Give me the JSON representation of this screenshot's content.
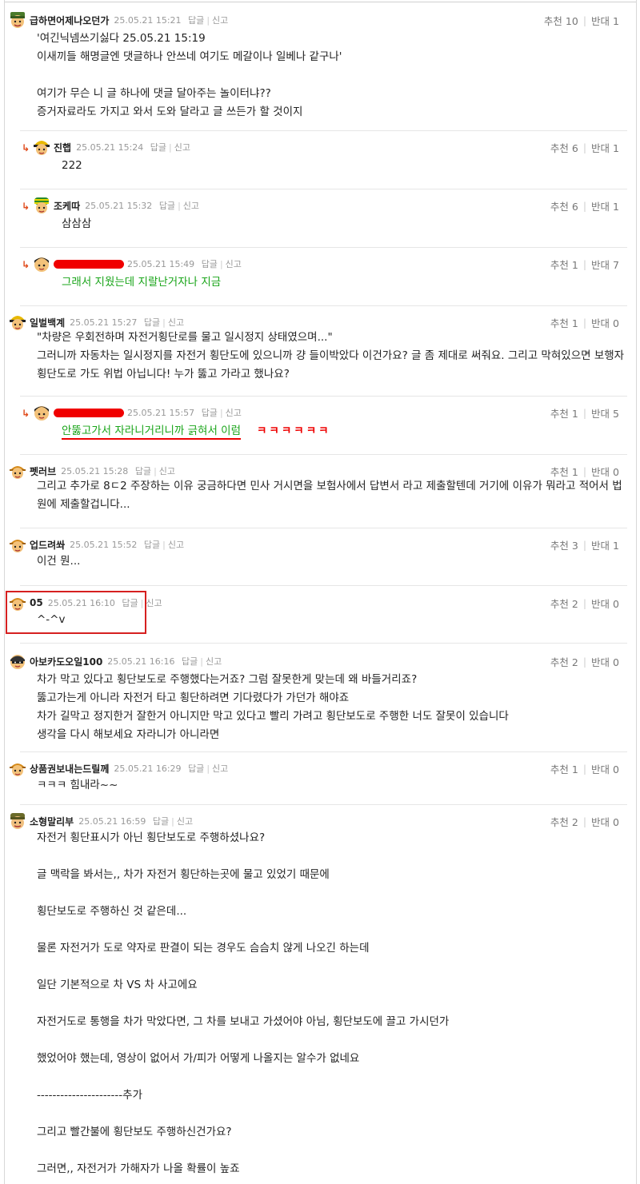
{
  "labels": {
    "reply": "답글",
    "report": "신고",
    "upvote": "추천",
    "downvote": "반대"
  },
  "comments": [
    {
      "nick": "급하면어제나오던가",
      "date": "25.05.21 15:21",
      "up": 10,
      "down": 1,
      "lines": [
        "'여긴닉넴쓰기싫다 25.05.21 15:19",
        "이새끼들 해명글엔 댓글하나 안쓰네 여기도 메갈이나 일베나 같구나'",
        "",
        "여기가 무슨 니 글 하나에 댓글 달아주는 놀이터냐??",
        "증거자료라도 가지고 와서 도와 달라고 글 쓰든가 할 것이지"
      ]
    },
    {
      "nick": "진햅",
      "date": "25.05.21 15:24",
      "up": 6,
      "down": 1,
      "lines": [
        "222"
      ]
    },
    {
      "nick": "조케따",
      "date": "25.05.21 15:32",
      "up": 6,
      "down": 1,
      "lines": [
        "삼삼삼"
      ]
    },
    {
      "nick": "",
      "date": "25.05.21 15:49",
      "up": 1,
      "down": 7,
      "lines": [
        "그래서 지웠는데 지랄난거자나 지금"
      ]
    },
    {
      "nick": "일벌백계",
      "date": "25.05.21 15:27",
      "up": 1,
      "down": 0,
      "lines": [
        "\"차량은 우회전하며 자전거횡단로를 물고 일시정지 상태였으며...\"",
        "그러니까 자동차는 일시정지를 자전거 횡단도에 있으니까 걍 들이박았다 이건가요? 글 좀 제대로 써줘요. 그리고 막혀있으면 보행자",
        "횡단도로 가도 위법 아닙니다! 누가 뚫고 가라고 했나요?"
      ]
    },
    {
      "nick": "",
      "date": "25.05.21 15:57",
      "up": 1,
      "down": 5,
      "lines": [
        "안뚫고가서 자라니거리니까 긁혀서 이럼"
      ],
      "extra": "ㅋㅋㅋㅋㅋㅋ"
    },
    {
      "nick": "펫러브",
      "date": "25.05.21 15:28",
      "up": 1,
      "down": 0,
      "lines": [
        "그리고 추가로 8ㄷ2 주장하는 이유 궁금하다면 민사 거시면을 보험사에서 답변서 라고 제출할텐데 거기에 이유가 뭐라고 적어서 법",
        "원에 제출할겁니다..."
      ]
    },
    {
      "nick": "업드려쏴",
      "date": "25.05.21 15:52",
      "up": 3,
      "down": 1,
      "lines": [
        "이건 뭔..."
      ]
    },
    {
      "nick": "05",
      "date": "25.05.21 16:10",
      "up": 2,
      "down": 0,
      "lines": [
        "^-^v"
      ]
    },
    {
      "nick": "아보카도오일100",
      "date": "25.05.21 16:16",
      "up": 2,
      "down": 0,
      "lines": [
        "차가 막고 있다고 횡단보도로 주행했다는거죠? 그럼 잘못한게 맞는데 왜 바들거리죠?",
        "뚫고가는게 아니라 자전거 타고 횡단하려면 기다렸다가 가던가 해야죠",
        "차가 길막고 정지한거 잘한거 아니지만 막고 있다고 빨리 가려고 횡단보도로 주행한 너도 잘못이 있습니다",
        "생각을 다시 해보세요 자라니가 아니라면"
      ]
    },
    {
      "nick": "상품권보내는드릴께",
      "date": "25.05.21 16:29",
      "up": 1,
      "down": 0,
      "lines": [
        "ㅋㅋㅋ 힘내라~~"
      ]
    },
    {
      "nick": "소형말리부",
      "date": "25.05.21 16:59",
      "up": 2,
      "down": 0,
      "lines": [
        "자전거 횡단표시가 아닌 횡단보도로 주행하셨나요?",
        "",
        "글 맥락을 봐서는,, 차가 자전거 횡단하는곳에 물고 있었기 때문에",
        "",
        "횡단보도로 주행하신 것 같은데...",
        "",
        "물론 자전거가 도로 약자로 판결이 되는 경우도 슴슴치 않게 나오긴 하는데",
        "",
        "일단 기본적으로 차 VS 차 사고에요",
        "",
        "자전거도로 통행을 차가 막았다면, 그 차를 보내고 가셨어야 아님, 횡단보도에 끌고 가시던가",
        "",
        "했었어야 했는데, 영상이 없어서 가/피가 어떻게 나올지는 알수가 없네요",
        "",
        "----------------------추가",
        "",
        "그리고 빨간불에 횡단보도 주행하신건가요?",
        "",
        "그러면,, 자전거가 가해자가 나올 확률이 높죠"
      ]
    }
  ],
  "colors": {
    "redaction": "#f00000",
    "reply_text": "#1aa51a",
    "highlight_box": "#d62020",
    "reply_arrow": "#e04a1a"
  }
}
